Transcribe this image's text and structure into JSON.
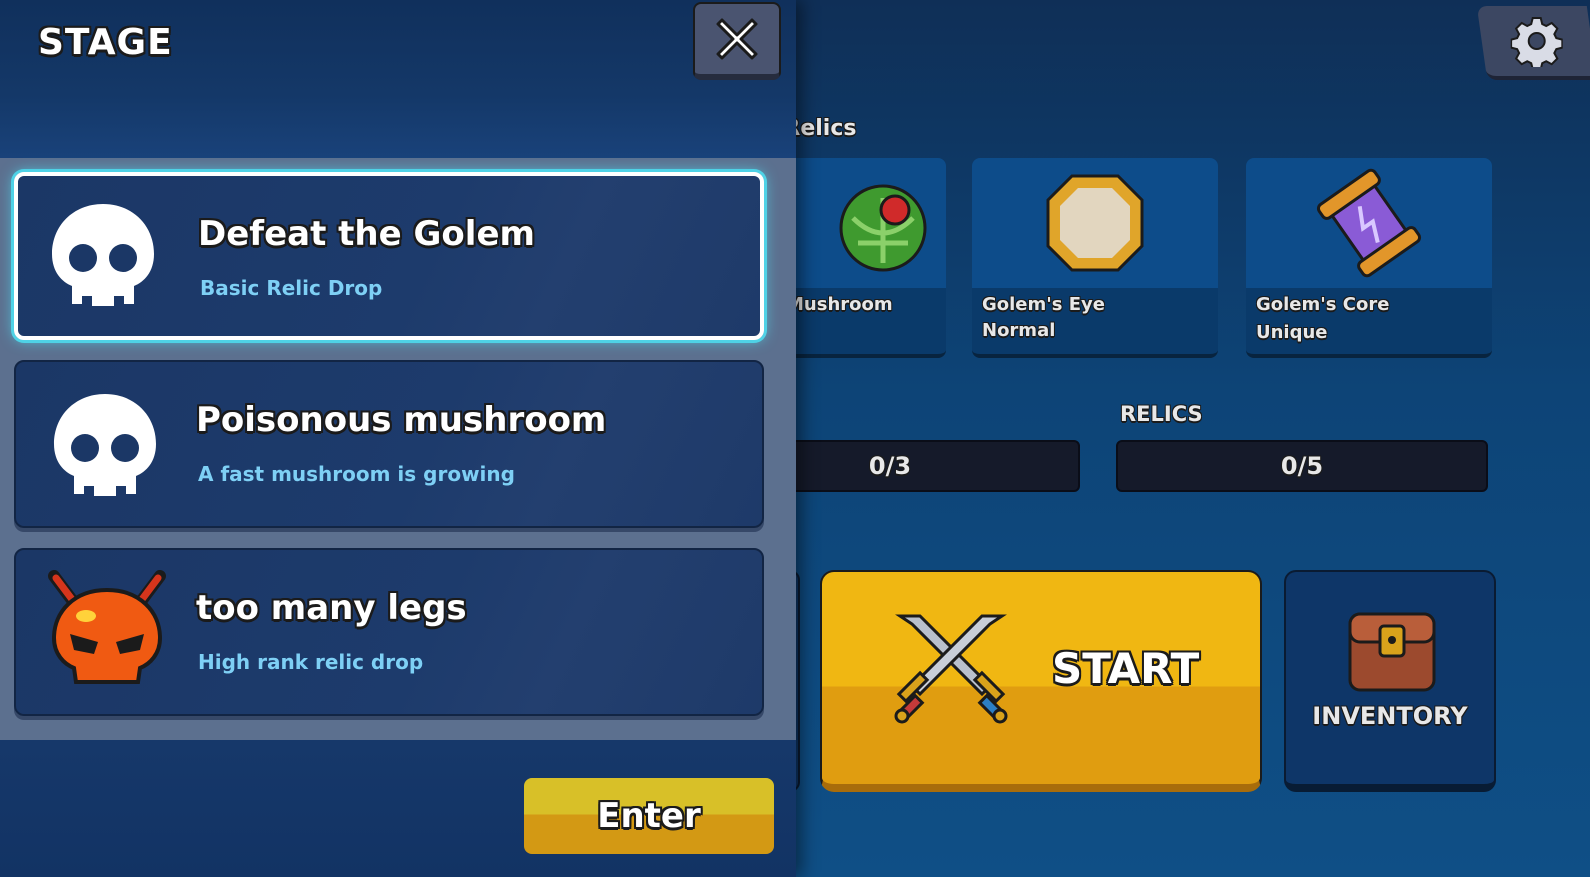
{
  "stage_panel": {
    "title": "STAGE",
    "close_icon": "close-x-icon",
    "stages": [
      {
        "name": "Defeat the Golem",
        "description": "Basic Relic Drop",
        "icon": "skull-icon",
        "selected": true
      },
      {
        "name": "Poisonous mushroom",
        "description": "A fast mushroom is growing",
        "icon": "skull-icon",
        "selected": false
      },
      {
        "name": "too many legs",
        "description": "High rank relic drop",
        "icon": "demon-skull-icon",
        "selected": false
      }
    ],
    "enter_label": "Enter"
  },
  "main": {
    "relics_heading": "d Relics",
    "relics": [
      {
        "name": "Mushroom",
        "rarity": "",
        "icon": "mushroom-relic-icon"
      },
      {
        "name": "Golem's Eye",
        "rarity": "Normal",
        "icon": "gem-relic-icon"
      },
      {
        "name": "Golem's Core",
        "rarity": "Unique",
        "icon": "core-relic-icon"
      }
    ],
    "stats": {
      "left_value": "0/3",
      "relics_label": "RELICS",
      "relics_value": "0/5"
    },
    "start_label": "START",
    "inventory_label": "INVENTORY",
    "settings_icon": "gear-icon"
  },
  "colors": {
    "accent_yellow": "#f0b712",
    "selection_glow": "#4fd2e6",
    "desc_text": "#7ed0f5"
  }
}
